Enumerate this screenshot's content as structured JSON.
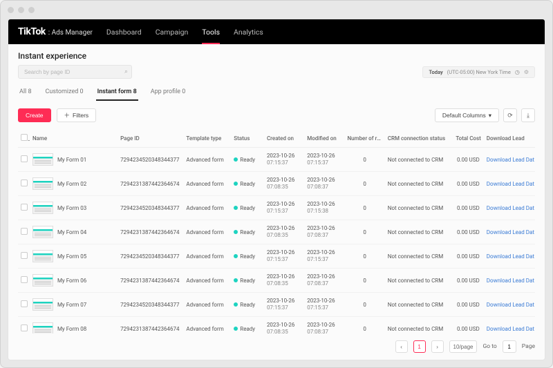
{
  "brand": {
    "logo": "TikTok",
    "sub": ": Ads Manager"
  },
  "topnav": [
    {
      "label": "Dashboard",
      "active": false
    },
    {
      "label": "Campaign",
      "active": false
    },
    {
      "label": "Tools",
      "active": true
    },
    {
      "label": "Analytics",
      "active": false
    }
  ],
  "page_title": "Instant experience",
  "search": {
    "placeholder": "Search by page ID"
  },
  "timezone": {
    "today_label": "Today",
    "tz_text": "(UTC-05:00) New York Time"
  },
  "tabs": [
    {
      "label": "All 8",
      "active": false
    },
    {
      "label": "Customized 0",
      "active": false
    },
    {
      "label": "Instant form 8",
      "active": true
    },
    {
      "label": "App profile 0",
      "active": false
    }
  ],
  "buttons": {
    "create": "Create",
    "filters": "Filters",
    "columns": "Default Columns"
  },
  "columns": [
    "Name",
    "Page ID",
    "Template type",
    "Status",
    "Created on",
    "Modified on",
    "Number of rel...",
    "CRM connection status",
    "Total Cost",
    "Download Lead"
  ],
  "rows": [
    {
      "name": "My Form 01",
      "page_id": "7294234520348344377",
      "template": "Advanced form",
      "status": "Ready",
      "created_d": "2023-10-26",
      "created_t": "07:15:37",
      "modified_d": "2023-10-26",
      "modified_t": "07:15:37",
      "num": "0",
      "crm": "Not connected to CRM",
      "cost": "0.00 USD",
      "dl": "Download Lead Dat"
    },
    {
      "name": "My Form 02",
      "page_id": "7294231387442364674",
      "template": "Advanced form",
      "status": "Ready",
      "created_d": "2023-10-26",
      "created_t": "07:08:35",
      "modified_d": "2023-10-26",
      "modified_t": "07:08:37",
      "num": "0",
      "crm": "Not connected to CRM",
      "cost": "0.00 USD",
      "dl": "Download Lead Dat"
    },
    {
      "name": "My Form 03",
      "page_id": "7294234520348344377",
      "template": "Advanced form",
      "status": "Ready",
      "created_d": "2023-10-26",
      "created_t": "07:15:37",
      "modified_d": "2023-10-26",
      "modified_t": "07:15:38",
      "num": "0",
      "crm": "Not connected to CRM",
      "cost": "0.00 USD",
      "dl": "Download Lead Dat"
    },
    {
      "name": "My Form 04",
      "page_id": "7294231387442364674",
      "template": "Advanced form",
      "status": "Ready",
      "created_d": "2023-10-26",
      "created_t": "07:08:35",
      "modified_d": "2023-10-26",
      "modified_t": "07:08:37",
      "num": "0",
      "crm": "Not connected to CRM",
      "cost": "0.00 USD",
      "dl": "Download Lead Dat"
    },
    {
      "name": "My Form 05",
      "page_id": "7294234520348344377",
      "template": "Advanced form",
      "status": "Ready",
      "created_d": "2023-10-26",
      "created_t": "07:15:37",
      "modified_d": "2023-10-26",
      "modified_t": "07:15:37",
      "num": "0",
      "crm": "Not connected to CRM",
      "cost": "0.00 USD",
      "dl": "Download Lead Dat"
    },
    {
      "name": "My Form 06",
      "page_id": "7294231387442364674",
      "template": "Advanced form",
      "status": "Ready",
      "created_d": "2023-10-26",
      "created_t": "07:08:35",
      "modified_d": "2023-10-26",
      "modified_t": "07:08:37",
      "num": "0",
      "crm": "Not connected to CRM",
      "cost": "0.00 USD",
      "dl": "Download Lead Dat"
    },
    {
      "name": "My Form 07",
      "page_id": "7294234520348344377",
      "template": "Advanced form",
      "status": "Ready",
      "created_d": "2023-10-26",
      "created_t": "07:15:37",
      "modified_d": "2023-10-26",
      "modified_t": "07:15:37",
      "num": "0",
      "crm": "Not connected to CRM",
      "cost": "0.00 USD",
      "dl": "Download Lead Dat"
    },
    {
      "name": "My Form 08",
      "page_id": "7294231387442364674",
      "template": "Advanced form",
      "status": "Ready",
      "created_d": "2023-10-26",
      "created_t": "07:08:35",
      "modified_d": "2023-10-26",
      "modified_t": "07:08:37",
      "num": "0",
      "crm": "Not connected to CRM",
      "cost": "0.00 USD",
      "dl": "Download Lead Dat"
    }
  ],
  "pagination": {
    "current": "1",
    "per_page": "10/page",
    "goto_label": "Go to",
    "goto_value": "1",
    "page_label": "Page"
  }
}
